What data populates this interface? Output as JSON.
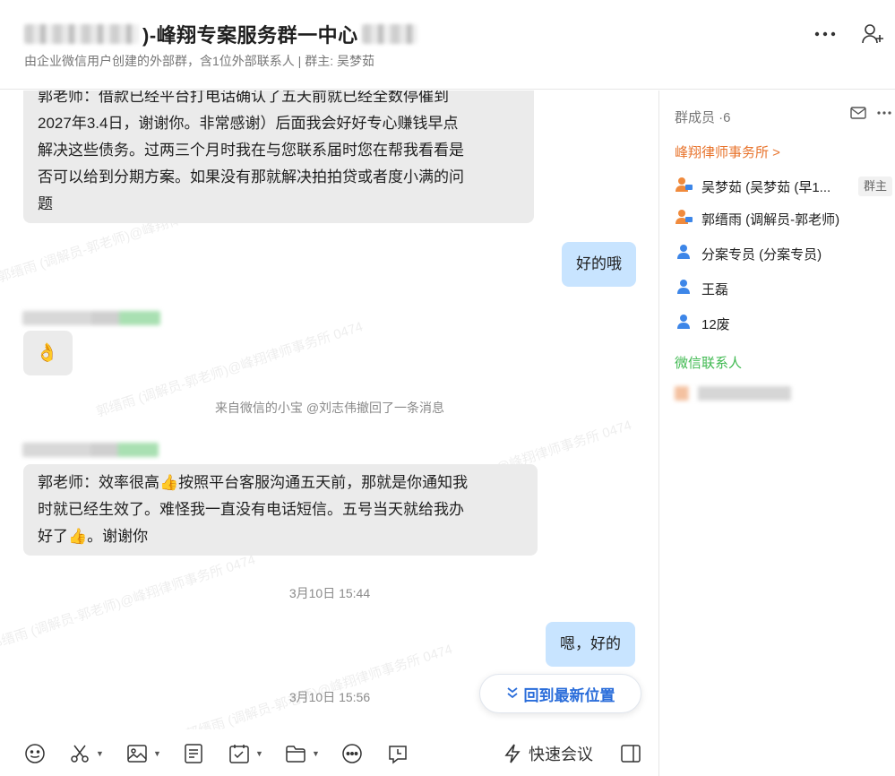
{
  "header": {
    "title": ")-峰翔专案服务群一中心",
    "subtitle": "由企业微信用户创建的外部群，含1位外部联系人 | 群主: 吴梦茹",
    "more_icon": "more-icon",
    "add_member_icon": "add-member-icon"
  },
  "messages": {
    "m1_lines": [
      "郭老师：借款已经平台打电话确认了五天前就已经全数停催到",
      "2027年3.4日，谢谢你。非常感谢）后面我会好好专心赚钱早点",
      "解决这些债务。过两三个月时我在与您联系届时您在帮我看看是",
      "否可以给到分期方案。如果没有那就解决拍拍贷或者度小满的问",
      "题"
    ],
    "m2": "好的哦",
    "m3_emoji": "👌",
    "recall_notice": "来自微信的小宝 @刘志伟撤回了一条消息",
    "m4_lines": [
      "郭老师：效率很高👍按照平台客服沟通五天前，那就是你通知我",
      "时就已经生效了。难怪我一直没有电话短信。五号当天就给我办",
      "好了👍。谢谢你"
    ],
    "time1": "3月10日 15:44",
    "m5": "嗯，好的",
    "time2": "3月10日 15:56"
  },
  "watermark": "郭缙雨 (调解员-郭老师)@峰翔律师事务所 0474",
  "jump_button": {
    "label": "回到最新位置"
  },
  "toolbar": {
    "quick_meeting": "快速会议"
  },
  "sidebar": {
    "member_count": "群成员 ·6",
    "org_name": "峰翔律师事务所 >",
    "members": [
      {
        "name": "吴梦茹 (吴梦茹 (早1...",
        "icon": "enterprise-user-icon"
      },
      {
        "name": "郭缙雨 (调解员-郭老师)",
        "icon": "enterprise-user-icon"
      },
      {
        "name": "分案专员 (分案专员)",
        "icon": "user-icon"
      },
      {
        "name": "王磊",
        "icon": "user-icon"
      },
      {
        "name": "12废",
        "icon": "user-icon"
      }
    ],
    "owner_badge": "群主",
    "wechat_section": "微信联系人"
  },
  "colors": {
    "incoming_bubble": "#ebebeb",
    "outgoing_bubble": "#c8e4ff",
    "accent_blue": "#2a6dda",
    "org_orange": "#e8742d",
    "wechat_green": "#3fb950"
  }
}
